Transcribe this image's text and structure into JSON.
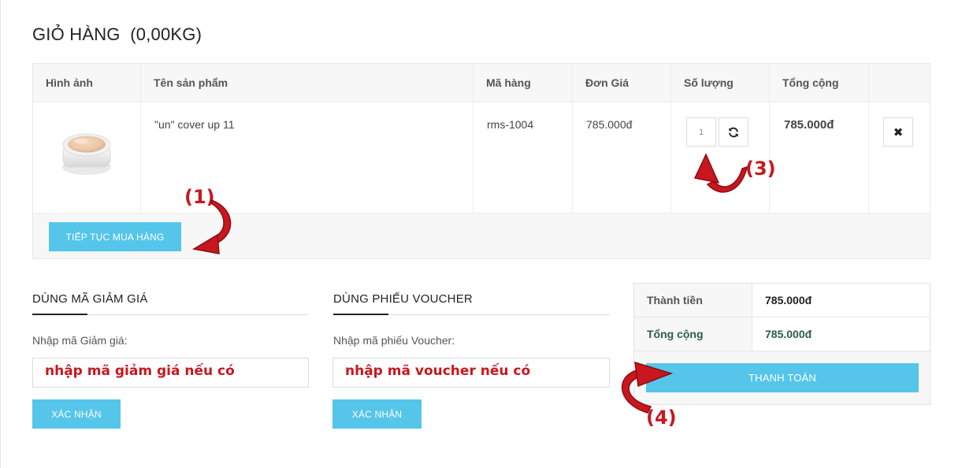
{
  "page": {
    "title": "GIỎ HÀNG  (0,00KG)"
  },
  "cart": {
    "headers": {
      "image": "Hình ảnh",
      "name": "Tên sản phẩm",
      "sku": "Mã hàng",
      "unit_price": "Đơn Giá",
      "quantity": "Số lượng",
      "total": "Tổng cộng"
    },
    "item": {
      "name": "\"un\" cover up 11",
      "sku": "rms-1004",
      "unit_price": "785.000đ",
      "quantity": "1",
      "total": "785.000đ"
    },
    "continue_label": "TIẾP TỤC MUA HÀNG",
    "refresh_icon": "refresh-icon",
    "remove_icon": "close-icon",
    "remove_glyph": "✖"
  },
  "coupon": {
    "title": "DÙNG MÃ GIẢM GIÁ",
    "label": "Nhập mã Giảm giá:",
    "hint": "nhập mã giảm giá nếu có",
    "button": "XÁC NHẬN"
  },
  "voucher": {
    "title": "DÙNG PHIẾU VOUCHER",
    "label": "Nhập mã phiếu Voucher:",
    "hint": "nhập mã voucher nếu có",
    "button": "XÁC NHẬN"
  },
  "totals": {
    "subtotal_label": "Thành tiền",
    "subtotal_value": "785.000đ",
    "total_label": "Tổng cộng",
    "total_value": "785.000đ",
    "checkout_label": "THANH TOÁN"
  },
  "annotations": {
    "a1": "(1)",
    "a3": "(3)",
    "a4": "(4)"
  },
  "colors": {
    "button": "#55c5e9",
    "annotation": "#c8171f",
    "total_text": "#2b5d4a"
  }
}
